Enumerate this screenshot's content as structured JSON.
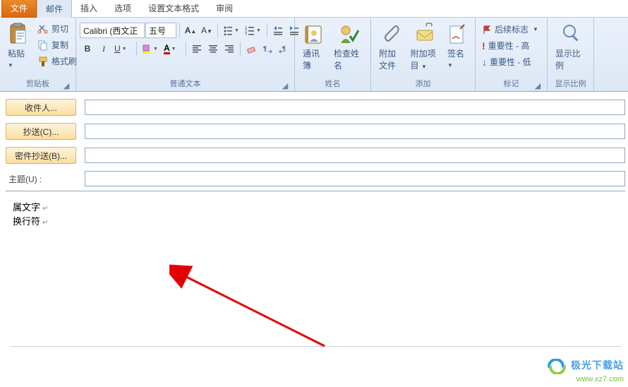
{
  "tabs": {
    "file": "文件",
    "mail": "邮件",
    "insert": "插入",
    "options": "选项",
    "format": "设置文本格式",
    "review": "审阅"
  },
  "ribbon": {
    "clipboard": {
      "paste": "粘贴",
      "cut": "剪切",
      "copy": "复制",
      "format_painter": "格式刷",
      "label": "剪贴板"
    },
    "font": {
      "name": "Calibri (西文正",
      "size": "五号",
      "bold": "B",
      "italic": "I",
      "underline": "U",
      "label": "普通文本"
    },
    "names": {
      "addressbook": "通讯簿",
      "check": "检查姓名",
      "label": "姓名"
    },
    "add": {
      "attach_file": "附加文件",
      "attach_item": "附加项目",
      "signature": "签名",
      "label": "添加"
    },
    "tags": {
      "followup": "后续标志",
      "importance_high": "重要性 - 高",
      "importance_low": "重要性 - 低",
      "label": "标记"
    },
    "zoom": {
      "zoom": "显示比例",
      "label": "显示比例"
    }
  },
  "fields": {
    "to": "收件人...",
    "cc": "抄送(C)...",
    "bcc": "密件抄送(B)...",
    "subject": "主题(U) :"
  },
  "body": {
    "line1": "属文字",
    "line2": "换行符"
  },
  "watermark": {
    "name": "极光下载站",
    "url": "www.xz7.com"
  }
}
